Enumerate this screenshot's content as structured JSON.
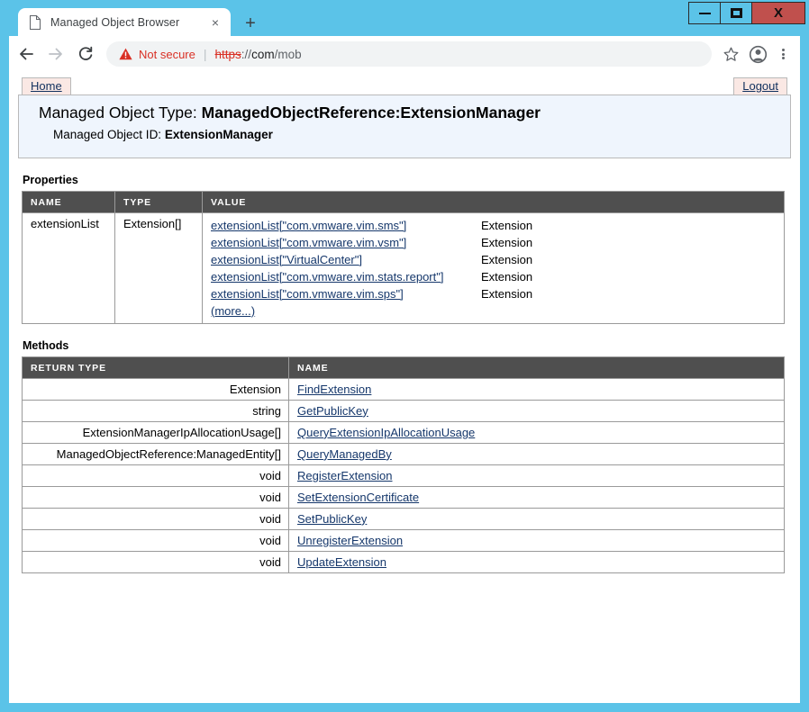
{
  "window": {
    "controls": {
      "minimize": "minimize-button",
      "maximize": "maximize-button",
      "close_label": "X"
    }
  },
  "browser": {
    "tab": {
      "title": "Managed Object Browser",
      "close_label": "×"
    },
    "new_tab_label": "+",
    "nav": {
      "back": "back-button",
      "forward": "forward-button",
      "reload": "reload-button"
    },
    "omnibox": {
      "security_label": "Not secure",
      "separator": "|",
      "url_scheme": "https",
      "url_sep": "://",
      "url_host": "com",
      "url_path": "/mob"
    },
    "actions": {
      "bookmark": "bookmark-star-icon",
      "profile": "profile-icon",
      "menu": "more-menu-icon"
    }
  },
  "page": {
    "nav": {
      "home": "Home",
      "logout": "Logout"
    },
    "object_header": {
      "type_label": "Managed Object Type:",
      "type_value": "ManagedObjectReference:ExtensionManager",
      "id_label": "Managed Object ID:",
      "id_value": "ExtensionManager"
    },
    "properties": {
      "title": "Properties",
      "columns": [
        "NAME",
        "TYPE",
        "VALUE"
      ],
      "rows": [
        {
          "name": "extensionList",
          "type": "Extension[]",
          "values": [
            {
              "link": "extensionList[\"com.vmware.vim.sms\"]",
              "type": "Extension"
            },
            {
              "link": "extensionList[\"com.vmware.vim.vsm\"]",
              "type": "Extension"
            },
            {
              "link": "extensionList[\"VirtualCenter\"]",
              "type": "Extension"
            },
            {
              "link": "extensionList[\"com.vmware.vim.stats.report\"]",
              "type": "Extension"
            },
            {
              "link": "extensionList[\"com.vmware.vim.sps\"]",
              "type": "Extension"
            }
          ],
          "more_label": "(more...)"
        }
      ]
    },
    "methods": {
      "title": "Methods",
      "columns": [
        "RETURN TYPE",
        "NAME"
      ],
      "rows": [
        {
          "return_type": "Extension",
          "name": "FindExtension"
        },
        {
          "return_type": "string",
          "name": "GetPublicKey"
        },
        {
          "return_type": "ExtensionManagerIpAllocationUsage[]",
          "name": "QueryExtensionIpAllocationUsage"
        },
        {
          "return_type": "ManagedObjectReference:ManagedEntity[]",
          "name": "QueryManagedBy"
        },
        {
          "return_type": "void",
          "name": "RegisterExtension"
        },
        {
          "return_type": "void",
          "name": "SetExtensionCertificate"
        },
        {
          "return_type": "void",
          "name": "SetPublicKey"
        },
        {
          "return_type": "void",
          "name": "UnregisterExtension"
        },
        {
          "return_type": "void",
          "name": "UpdateExtension"
        }
      ]
    }
  },
  "colors": {
    "frame": "#5bc3e8",
    "close_button": "#c0504d",
    "table_header": "#4f4f4f",
    "link": "#15376b",
    "nav_tab": "#fae8e4",
    "object_box": "#eff5fd",
    "not_secure": "#d93025"
  }
}
